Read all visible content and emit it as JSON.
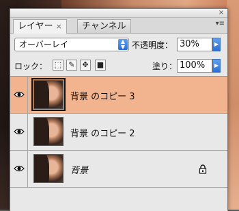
{
  "panel": {
    "tabs": [
      {
        "label": "レイヤー",
        "close": "×"
      },
      {
        "label": "チャンネル"
      }
    ],
    "close_button": "×",
    "menu_icon": "▾≡"
  },
  "blend_mode": {
    "value": "オーバーレイ",
    "options_visible": [
      "オーバーレイ"
    ]
  },
  "opacity": {
    "label": "不透明度：",
    "value": "30%"
  },
  "lock": {
    "label": "ロック：",
    "icons": [
      "lock-transparent-icon",
      "lock-paint-icon",
      "lock-move-icon",
      "lock-all-icon"
    ]
  },
  "fill": {
    "label": "塗り：",
    "value": "100%"
  },
  "layers": [
    {
      "name": "背景 のコピー 3",
      "visible": true,
      "selected": true,
      "locked": false
    },
    {
      "name": "背景 のコピー 2",
      "visible": true,
      "selected": false,
      "locked": false
    },
    {
      "name": "背景",
      "visible": true,
      "selected": false,
      "locked": true
    }
  ],
  "colors": {
    "selected_row": "#f2b38f",
    "panel_bg": "#e8e8e8",
    "accent_blue": "#2a6fd6"
  }
}
